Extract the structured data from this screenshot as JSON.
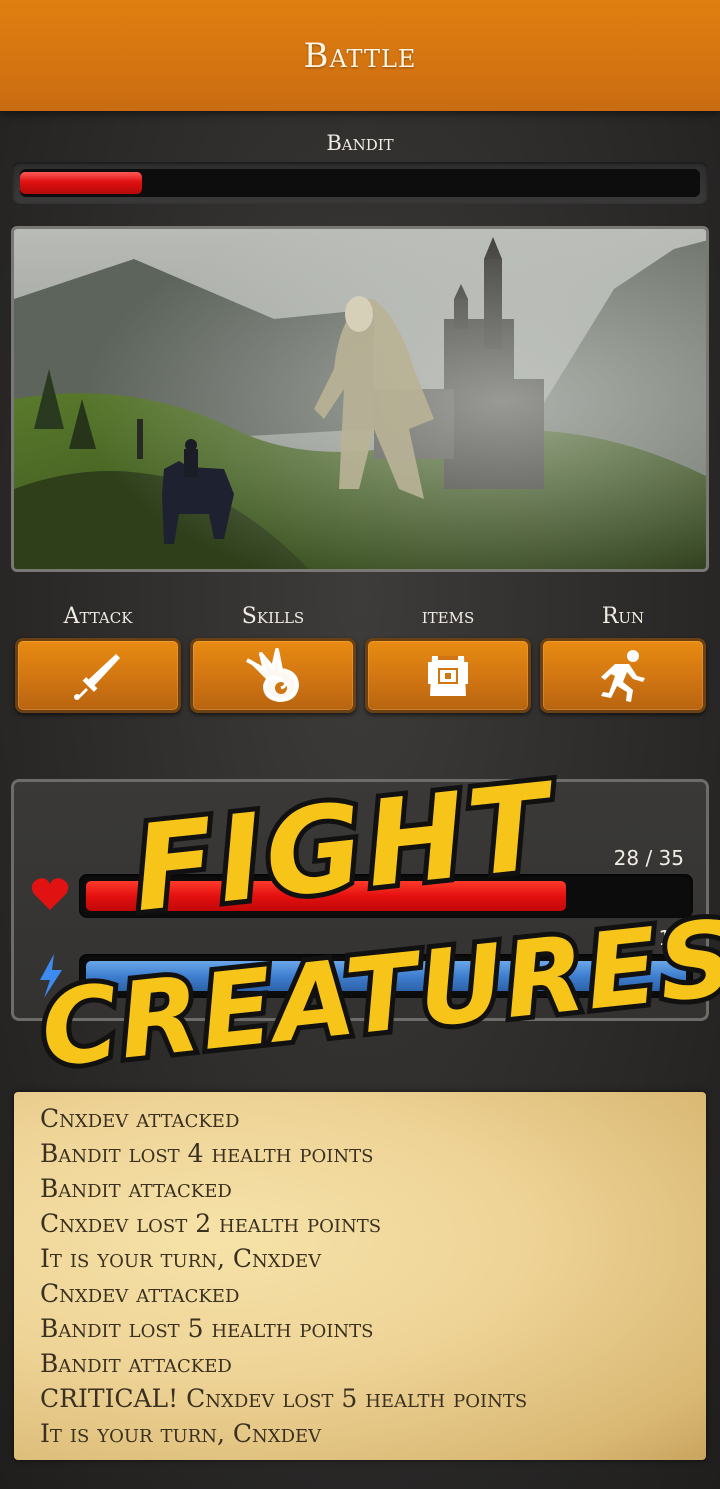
{
  "header": {
    "title": "Battle"
  },
  "enemy": {
    "name": "Bandit",
    "health_fraction": 0.18
  },
  "actions": [
    {
      "label": "Attack",
      "icon": "sword-icon"
    },
    {
      "label": "Skills",
      "icon": "magic-swirl-icon"
    },
    {
      "label": "items",
      "icon": "backpack-icon"
    },
    {
      "label": "Run",
      "icon": "running-man-icon"
    }
  ],
  "player": {
    "hp_text": "28 / 35",
    "hp_fraction": 0.8,
    "mp_text": "10",
    "mp_fraction": 1.0,
    "hp_icon": "heart-icon",
    "mp_icon": "lightning-icon"
  },
  "promo": {
    "line1": "FIGHT",
    "line2": "CREATURES"
  },
  "colors": {
    "accent": "#d47411",
    "hp": "#e41010",
    "mp": "#3f7fd0"
  },
  "log": {
    "lines": [
      "Cnxdev attacked",
      "Bandit lost 4 health points",
      "Bandit attacked",
      "Cnxdev lost 2 health points",
      "It is your turn, Cnxdev",
      "Cnxdev attacked",
      "Bandit lost 5 health points",
      "Bandit attacked",
      "CRITICAL! Cnxdev lost 5 health points",
      "It is your turn, Cnxdev"
    ]
  }
}
